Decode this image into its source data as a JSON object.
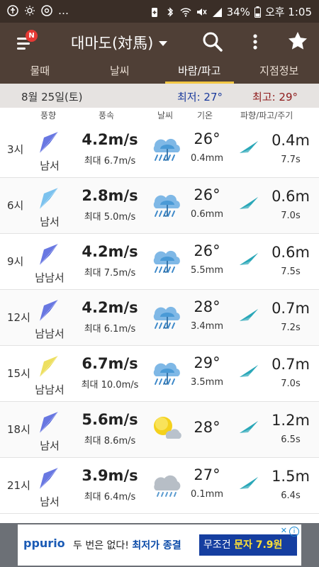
{
  "status_bar": {
    "battery": "34%",
    "time": "오후 1:05",
    "left_icons": [
      "accessibility-icon",
      "weather-status-icon",
      "chrome-icon",
      "more-dots"
    ],
    "right_icons": [
      "battery-saver-icon",
      "bluetooth-icon",
      "wifi-icon",
      "mute-icon",
      "signal-icon",
      "battery-icon"
    ]
  },
  "app_bar": {
    "menu_badge": "N",
    "location": "대마도(対馬)",
    "icons": [
      "menu-icon",
      "search-icon",
      "more-vert-icon",
      "star-icon"
    ]
  },
  "tabs": [
    {
      "label": "물때",
      "active": false
    },
    {
      "label": "날씨",
      "active": false
    },
    {
      "label": "바람/파고",
      "active": true
    },
    {
      "label": "지점정보",
      "active": false
    }
  ],
  "date_bar": {
    "date": "8월 25일(토)",
    "min_temp": "최저: 27°",
    "max_temp": "최고: 29°"
  },
  "columns": {
    "wind_dir": "풍향",
    "wind_speed": "풍속",
    "weather": "날씨",
    "temperature": "기온",
    "wave": "파향/파고/주기"
  },
  "rows": [
    {
      "time": "3시",
      "dir": "남서",
      "arrow_color": "#2a3fd6",
      "speed": "4.2m/s",
      "gust": "최대 6.7m/s",
      "weather": "rain-heavy-icon",
      "temp": "26°",
      "rain": "0.4mm",
      "wave_height": "0.4m",
      "wave_period": "7.7s"
    },
    {
      "time": "6시",
      "dir": "남서",
      "arrow_color": "#46a9e8",
      "speed": "2.8m/s",
      "gust": "최대 5.0m/s",
      "weather": "rain-heavy-icon",
      "temp": "26°",
      "rain": "0.6mm",
      "wave_height": "0.6m",
      "wave_period": "7.0s"
    },
    {
      "time": "9시",
      "dir": "남남서",
      "arrow_color": "#2a3fd6",
      "speed": "4.2m/s",
      "gust": "최대 7.5m/s",
      "weather": "rain-heavy-icon",
      "temp": "26°",
      "rain": "5.5mm",
      "wave_height": "0.6m",
      "wave_period": "7.5s"
    },
    {
      "time": "12시",
      "dir": "남남서",
      "arrow_color": "#2a3fd6",
      "speed": "4.2m/s",
      "gust": "최대 6.1m/s",
      "weather": "rain-heavy-icon",
      "temp": "28°",
      "rain": "3.4mm",
      "wave_height": "0.7m",
      "wave_period": "7.2s"
    },
    {
      "time": "15시",
      "dir": "남남서",
      "arrow_color": "#e6d11c",
      "speed": "6.7m/s",
      "gust": "최대 10.0m/s",
      "weather": "rain-heavy-icon",
      "temp": "29°",
      "rain": "3.5mm",
      "wave_height": "0.7m",
      "wave_period": "7.0s"
    },
    {
      "time": "18시",
      "dir": "남서",
      "arrow_color": "#2a3fd6",
      "speed": "5.6m/s",
      "gust": "최대 8.6m/s",
      "weather": "sun-cloud-icon",
      "temp": "28°",
      "rain": "",
      "wave_height": "1.2m",
      "wave_period": "6.5s"
    },
    {
      "time": "21시",
      "dir": "남서",
      "arrow_color": "#2a3fd6",
      "speed": "3.9m/s",
      "gust": "최대 6.4m/s",
      "weather": "cloud-rain-icon",
      "temp": "27°",
      "rain": "0.1mm",
      "wave_height": "1.5m",
      "wave_period": "6.4s"
    }
  ],
  "ad": {
    "brand": "ppurio",
    "text_normal": "두 번은 없다! ",
    "text_bold": "최저가 종결",
    "cta_normal": "무조건 ",
    "cta_highlight": "문자 7.9원",
    "info": "i",
    "close": "✕"
  },
  "colors": {
    "app_bar": "#4f3f36",
    "status_bar": "#3a2e27",
    "tab_indicator": "#f2c744",
    "min_temp": "#1a3a9c",
    "max_temp": "#8e1a1a",
    "wave_arrow": "#2aa7b8"
  }
}
